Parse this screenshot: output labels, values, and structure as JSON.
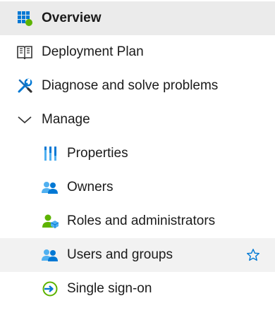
{
  "nav": {
    "overview": {
      "label": "Overview",
      "icon": "grid-icon"
    },
    "deployment_plan": {
      "label": "Deployment Plan",
      "icon": "book-icon"
    },
    "diagnose": {
      "label": "Diagnose and solve problems",
      "icon": "wrench-screwdriver-icon"
    },
    "manage": {
      "label": "Manage",
      "icon": "chevron-down-icon",
      "expanded": true
    },
    "manage_items": {
      "properties": {
        "label": "Properties",
        "icon": "properties-bars-icon"
      },
      "owners": {
        "label": "Owners",
        "icon": "users-icon"
      },
      "roles": {
        "label": "Roles and administrators",
        "icon": "user-role-icon"
      },
      "users_groups": {
        "label": "Users and groups",
        "icon": "users-icon",
        "favorite_icon": "star-outline-icon"
      },
      "sso": {
        "label": "Single sign-on",
        "icon": "sign-in-arrow-icon"
      }
    }
  },
  "colors": {
    "accent_blue": "#0078d4",
    "light_blue": "#50b0f0",
    "green": "#5db300",
    "active_bg": "#ebebeb",
    "selected_bg": "#f2f2f2"
  }
}
